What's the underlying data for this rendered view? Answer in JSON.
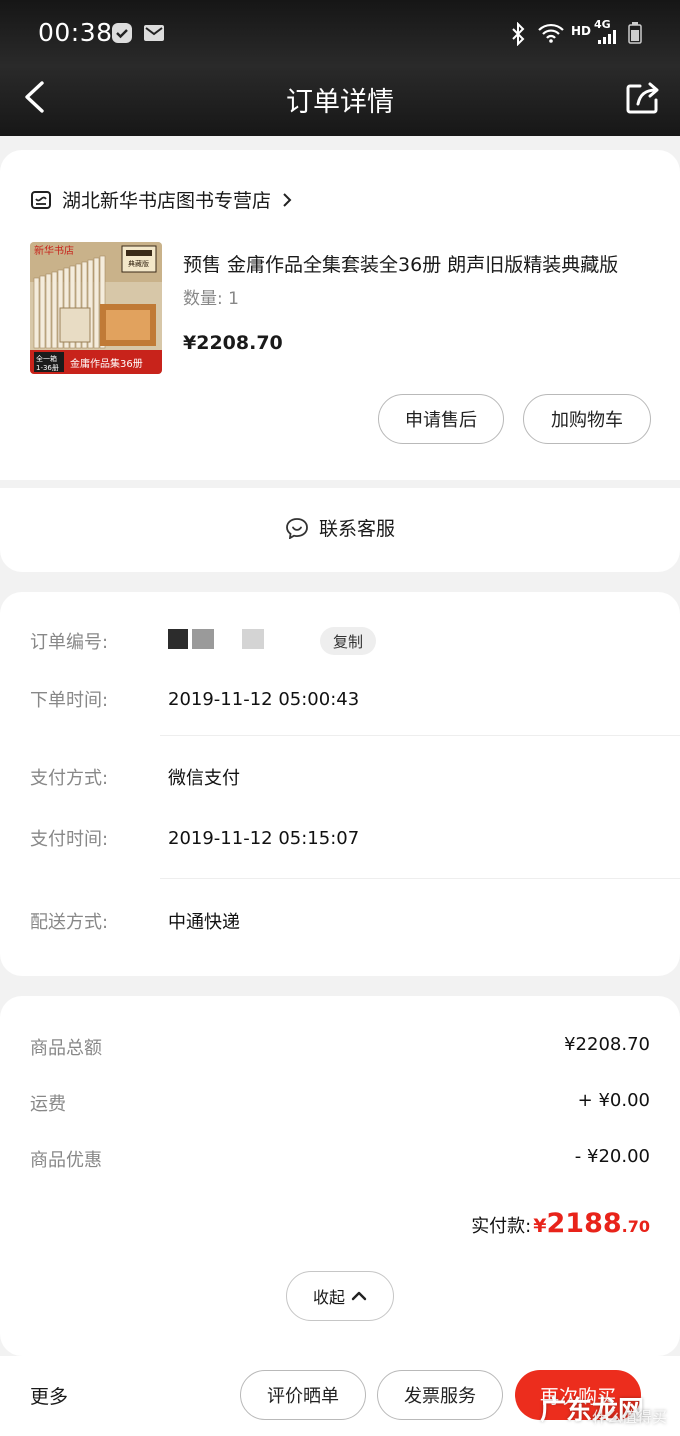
{
  "status_bar": {
    "time": "00:38",
    "net_hd": "HD",
    "net_4g": "4G"
  },
  "header": {
    "title": "订单详情"
  },
  "store": {
    "name": "湖北新华书店图书专营店"
  },
  "product": {
    "title": "预售 金庸作品全集套装全36册 朗声旧版精装典藏版",
    "quantity": "数量: 1",
    "price": "¥2208.70",
    "thumb_text": {
      "publisher": "新华书店",
      "label_a": "全一箱",
      "label_b": "1-36册",
      "banner": "金庸作品集36册",
      "tag": "典藏版"
    }
  },
  "actions": {
    "after_sale": "申请售后",
    "add_cart": "加购物车",
    "contact": "联系客服"
  },
  "order_info": {
    "order_no_label": "订单编号:",
    "copy": "复制",
    "order_time_label": "下单时间:",
    "order_time": "2019-11-12 05:00:43",
    "pay_method_label": "支付方式:",
    "pay_method": "微信支付",
    "pay_time_label": "支付时间:",
    "pay_time": "2019-11-12 05:15:07",
    "delivery_label": "配送方式:",
    "delivery": "中通快递"
  },
  "summary": {
    "total_label": "商品总额",
    "total": "¥2208.70",
    "shipping_label": "运费",
    "shipping": "+ ¥0.00",
    "discount_label": "商品优惠",
    "discount": "- ¥20.00",
    "paid_label": "实付款:",
    "paid_currency": "¥",
    "paid_int": "2188",
    "paid_dec": ".70",
    "collapse": "收起"
  },
  "bottom": {
    "more": "更多",
    "review": "评价晒单",
    "invoice": "发票服务",
    "rebuy": "再次购买"
  },
  "watermark": {
    "main": "广东龙网",
    "sub": "什么值得买"
  },
  "colors": {
    "accent_red": "#ec2d1d",
    "price_red": "#e8231a",
    "header_bg": "#1f1f1f"
  }
}
